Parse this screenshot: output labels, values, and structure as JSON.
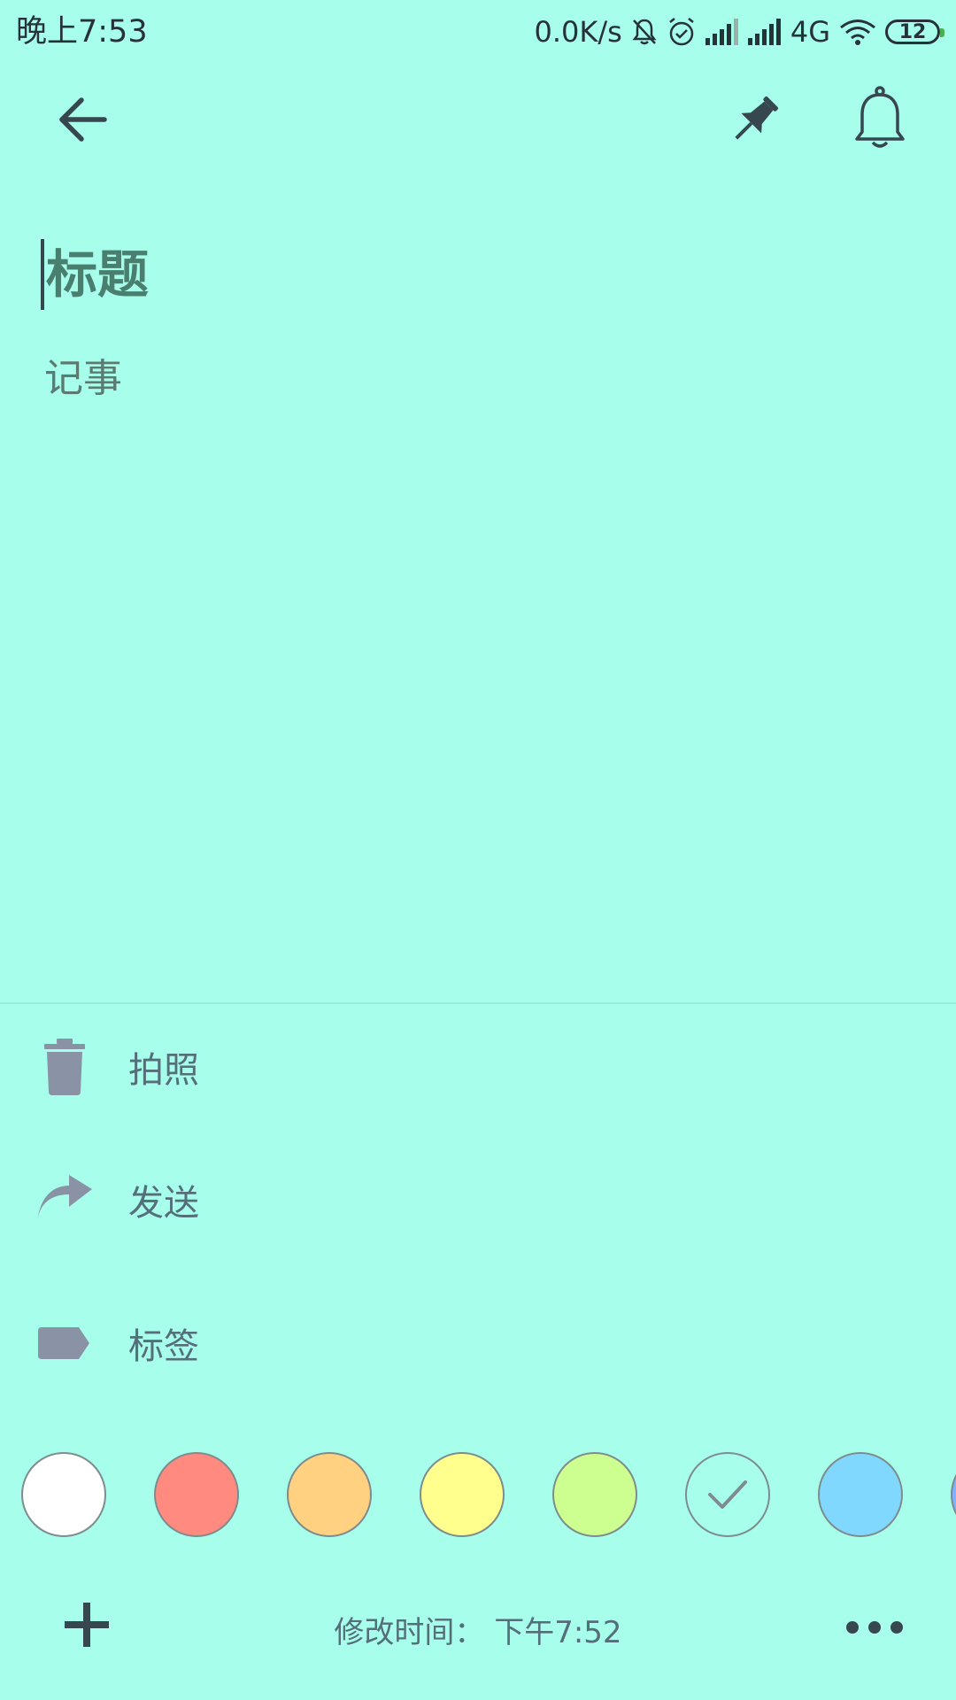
{
  "status_bar": {
    "time": "晚上7:53",
    "net_speed": "0.0K/s",
    "network_type": "4G",
    "battery_level": "12",
    "icons": [
      "mute-bell-icon",
      "alarm-icon",
      "signal-icon",
      "signal-icon",
      "wifi-icon"
    ]
  },
  "toolbar": {
    "back_icon": "arrow-back-icon",
    "pin_icon": "pin-icon",
    "reminder_icon": "bell-icon"
  },
  "note": {
    "title_placeholder": "标题",
    "body_placeholder": "记事"
  },
  "menu": {
    "items": [
      {
        "label": "拍照",
        "icon": "trash-icon"
      },
      {
        "label": "发送",
        "icon": "share-arrow-icon"
      },
      {
        "label": "标签",
        "icon": "label-tag-icon"
      }
    ]
  },
  "colors": {
    "swatches": [
      {
        "name": "white",
        "color": "#FFFFFF",
        "selected": false
      },
      {
        "name": "red",
        "color": "#FF8A80",
        "selected": false
      },
      {
        "name": "orange",
        "color": "#FFD180",
        "selected": false
      },
      {
        "name": "yellow",
        "color": "#FFFF8D",
        "selected": false
      },
      {
        "name": "green",
        "color": "#CCFF90",
        "selected": false
      },
      {
        "name": "teal",
        "color": "#A7FFEB",
        "selected": true
      },
      {
        "name": "blue",
        "color": "#80D8FF",
        "selected": false
      },
      {
        "name": "dark-blue",
        "color": "#82B1FF",
        "selected": false
      }
    ]
  },
  "footer": {
    "modified_text": "修改时间： 下午7:52"
  },
  "theme": {
    "background": "#A7FFEB",
    "icon_dark": "#37474F",
    "icon_muted": "#8A93A5"
  }
}
